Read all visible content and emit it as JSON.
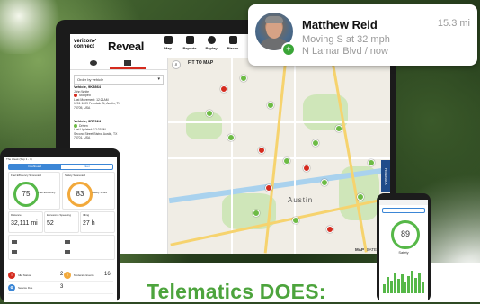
{
  "notification": {
    "name": "Matthew Reid",
    "distance": "15.3 mi",
    "status": "Moving S at 32 mph",
    "location": "N Lamar Blvd / now",
    "badge_icon": "plus-icon",
    "accent_color": "#3aa537"
  },
  "laptop": {
    "brand_top": "verizon✓",
    "brand_bottom": "connect",
    "app_name": "Reveal",
    "nav": [
      {
        "label": "Map",
        "icon": "map-icon"
      },
      {
        "label": "Reports",
        "icon": "reports-icon"
      },
      {
        "label": "Replay",
        "icon": "replay-icon"
      },
      {
        "label": "Places",
        "icon": "places-icon"
      },
      {
        "label": "Alerts",
        "icon": "alerts-icon"
      }
    ],
    "sidebar": {
      "order_by": "Order by vehicle",
      "vehicles": [
        {
          "title": "Vehicle, 9K5864",
          "driver": "John White",
          "status": "Stopped",
          "detail1": "Last Movement: 12:21AM",
          "detail2": "1201 1009 Ferndale St, Austin, TX",
          "detail3": "78705, USA",
          "status_color": "#d52b1e"
        },
        {
          "title": "Vehicle, 3R7924",
          "driver": "",
          "status": "Driven",
          "detail1": "Last Updated: 12:31PM",
          "detail2": "Second Street Bistro, Austin, TX",
          "detail3": "78701, USA",
          "status_color": "#6dbb45"
        }
      ]
    },
    "map": {
      "fit_label": "FIT TO MAP",
      "city_label": "Austin",
      "feedback_label": "FEEDBACK",
      "type_map": "MAP",
      "type_satellite": "SATELLITE"
    }
  },
  "tablet": {
    "header": "The Week (Sep 1 - 7)",
    "tabs": [
      "Dashboard",
      "Fleet"
    ],
    "fuel_title": "Fuel Efficiency Scorecard",
    "fuel_score": "75",
    "fuel_label": "Fuel Efficiency",
    "safety_title": "Safety Scorecard",
    "safety_score": "83",
    "safety_label": "Safety Score",
    "stat1_label": "Distance",
    "stat1_value": "32,111 mi",
    "stat2_label": "Excessive Speeding",
    "stat2_value": "52",
    "stat3_label": "Idling",
    "stat3_value": "27 h",
    "rows": [
      {
        "label": "Idle Status",
        "count": "2"
      },
      {
        "label": "Moderate Events",
        "count": "16"
      },
      {
        "label": "Service Due",
        "count": "3"
      }
    ],
    "fuel_color": "#56b848",
    "safety_color": "#f2a93b"
  },
  "phone": {
    "score": "89",
    "label": "Safety"
  },
  "headline": "Telematics DOES:"
}
